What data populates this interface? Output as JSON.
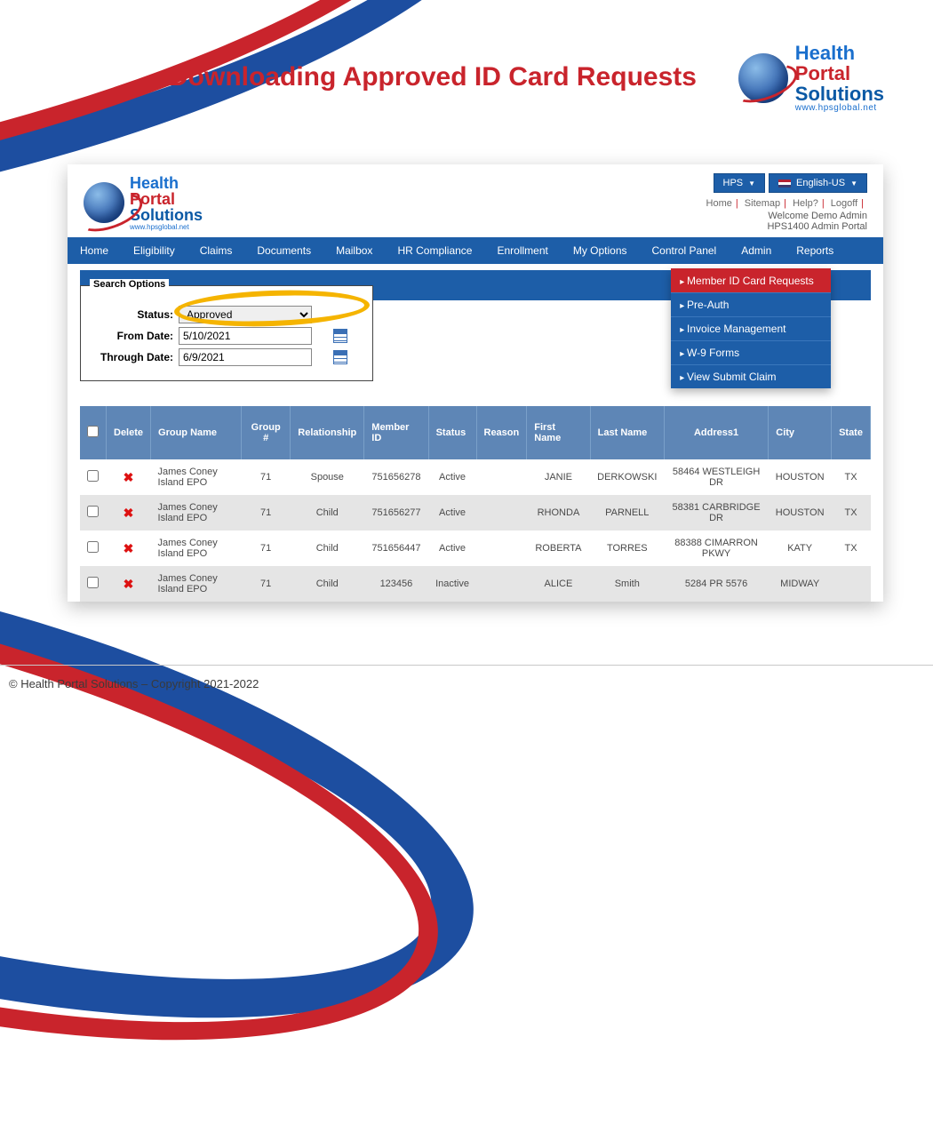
{
  "slide": {
    "title": "Downloading Approved ID Card Requests",
    "brand": {
      "l1": "Health",
      "l2": "Portal",
      "l3": "Solutions",
      "url": "www.hpsglobal.net"
    }
  },
  "portal": {
    "brand": {
      "l1": "Health",
      "l2": "Portal",
      "l3": "Solutions",
      "url": "www.hpsglobal.net"
    },
    "lang_chips": {
      "org": "HPS",
      "locale": "English-US"
    },
    "util": {
      "home": "Home",
      "sitemap": "Sitemap",
      "help": "Help?",
      "logoff": "Logoff"
    },
    "welcome": "Welcome Demo Admin",
    "portal_name": "HPS1400 Admin Portal",
    "nav": [
      "Home",
      "Eligibility",
      "Claims",
      "Documents",
      "Mailbox",
      "HR Compliance",
      "Enrollment",
      "My Options",
      "Control Panel",
      "Admin",
      "Reports"
    ],
    "submenu": [
      "Member ID Card Requests",
      "Pre-Auth",
      "Invoice Management",
      "W-9 Forms",
      "View Submit Claim"
    ]
  },
  "search": {
    "legend": "Search Options",
    "labels": {
      "status": "Status:",
      "from": "From Date:",
      "through": "Through Date:"
    },
    "status_value": "Approved",
    "from_value": "5/10/2021",
    "through_value": "6/9/2021"
  },
  "table": {
    "headers": [
      "",
      "Delete",
      "Group Name",
      "Group #",
      "Relationship",
      "Member ID",
      "Status",
      "Reason",
      "First Name",
      "Last Name",
      "Address1",
      "City",
      "State"
    ],
    "rows": [
      {
        "group": "James Coney Island EPO",
        "gnum": "71",
        "rel": "Spouse",
        "mid": "751656278",
        "status": "Active",
        "reason": "",
        "first": "JANIE",
        "last": "DERKOWSKI",
        "addr": "58464 WESTLEIGH DR",
        "city": "HOUSTON",
        "state": "TX"
      },
      {
        "group": "James Coney Island EPO",
        "gnum": "71",
        "rel": "Child",
        "mid": "751656277",
        "status": "Active",
        "reason": "",
        "first": "RHONDA",
        "last": "PARNELL",
        "addr": "58381 CARBRIDGE DR",
        "city": "HOUSTON",
        "state": "TX"
      },
      {
        "group": "James Coney Island EPO",
        "gnum": "71",
        "rel": "Child",
        "mid": "751656447",
        "status": "Active",
        "reason": "",
        "first": "ROBERTA",
        "last": "TORRES",
        "addr": "88388 CIMARRON PKWY",
        "city": "KATY",
        "state": "TX"
      },
      {
        "group": "James Coney Island EPO",
        "gnum": "71",
        "rel": "Child",
        "mid": "123456",
        "status": "Inactive",
        "reason": "",
        "first": "ALICE",
        "last": "Smith",
        "addr": "5284 PR 5576",
        "city": "MIDWAY",
        "state": ""
      }
    ]
  },
  "footer": "© Health Portal Solutions – Copyright 2021-2022"
}
